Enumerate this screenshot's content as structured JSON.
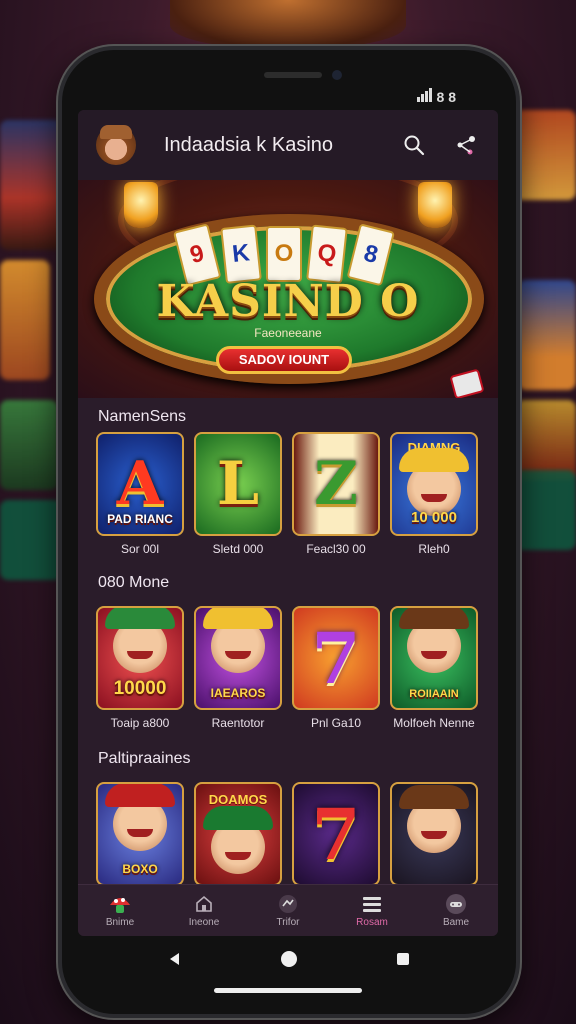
{
  "app": {
    "title": "Indaadsia k Kasino"
  },
  "icons": {
    "search": "search-icon",
    "share": "share-icon",
    "avatar": "avatar-icon"
  },
  "hero": {
    "cards": [
      "9",
      "K",
      "O",
      "Q",
      "8"
    ],
    "title": "KASIND O",
    "subtitle": "Faeoneeane",
    "button_label": "SADOV IOUNT"
  },
  "sections": [
    {
      "title": "NamenSens",
      "games": [
        {
          "caption": "Sor 00l",
          "art": "A",
          "badge": "PAD RIANC"
        },
        {
          "caption": "Sletd 000",
          "art": "L",
          "badge": ""
        },
        {
          "caption": "Feacl30 00",
          "art": "Z",
          "badge": ""
        },
        {
          "caption": "Rleh0",
          "art": "DIAMNG",
          "badge": "10 000"
        }
      ]
    },
    {
      "title": "080 Mone",
      "games": [
        {
          "caption": "Toaip a800",
          "art": "face",
          "badge": "10000"
        },
        {
          "caption": "Raentotor",
          "art": "face",
          "badge": "IAEAROS"
        },
        {
          "caption": "Pnl Ga10",
          "art": "7",
          "badge": ""
        },
        {
          "caption": "Molfoeh Nenne",
          "art": "face",
          "badge": "ROIIAAIN"
        }
      ]
    },
    {
      "title": "Paltipraaines",
      "games": [
        {
          "caption": "",
          "art": "face",
          "badge": "BOXO"
        },
        {
          "caption": "",
          "art": "face",
          "badge": "DOAMOS"
        },
        {
          "caption": "",
          "art": "7",
          "badge": ""
        },
        {
          "caption": "",
          "art": "face",
          "badge": ""
        }
      ]
    }
  ],
  "bottom_nav": [
    {
      "label": "Bnime",
      "icon": "mushroom-icon",
      "active": false
    },
    {
      "label": "Ineone",
      "icon": "home-icon",
      "active": false
    },
    {
      "label": "Trifor",
      "icon": "chart-icon",
      "active": false
    },
    {
      "label": "Rosam",
      "icon": "menu-icon",
      "active": true
    },
    {
      "label": "Bame",
      "icon": "gamepad-icon",
      "active": false
    }
  ],
  "status": {
    "text": "8 8"
  },
  "colors": {
    "accent": "#e06aa8",
    "gold": "#f6cf4a",
    "table_green": "#1f7a2c",
    "background": "#2a1c2a"
  }
}
